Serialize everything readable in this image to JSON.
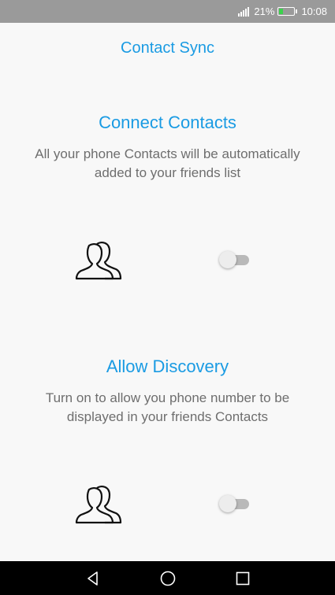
{
  "status_bar": {
    "battery_percent": "21%",
    "time": "10:08",
    "icons": [
      "signal-icon",
      "battery-icon"
    ]
  },
  "header": {
    "title": "Contact Sync"
  },
  "sections": [
    {
      "title": "Connect Contacts",
      "description": "All your phone Contacts will be automatically added to your friends list",
      "icon": "contacts-icon",
      "toggle_on": false
    },
    {
      "title": "Allow Discovery",
      "description": "Turn on to allow you phone number to be displayed in your friends Contacts",
      "icon": "contacts-icon",
      "toggle_on": false
    }
  ],
  "nav_bar": {
    "icons": [
      "back-icon",
      "home-icon",
      "recents-icon"
    ]
  },
  "colors": {
    "accent": "#1a9be3",
    "status_bar": "#9a9a9a",
    "background": "#f8f8f8",
    "nav_bar": "#000000"
  }
}
